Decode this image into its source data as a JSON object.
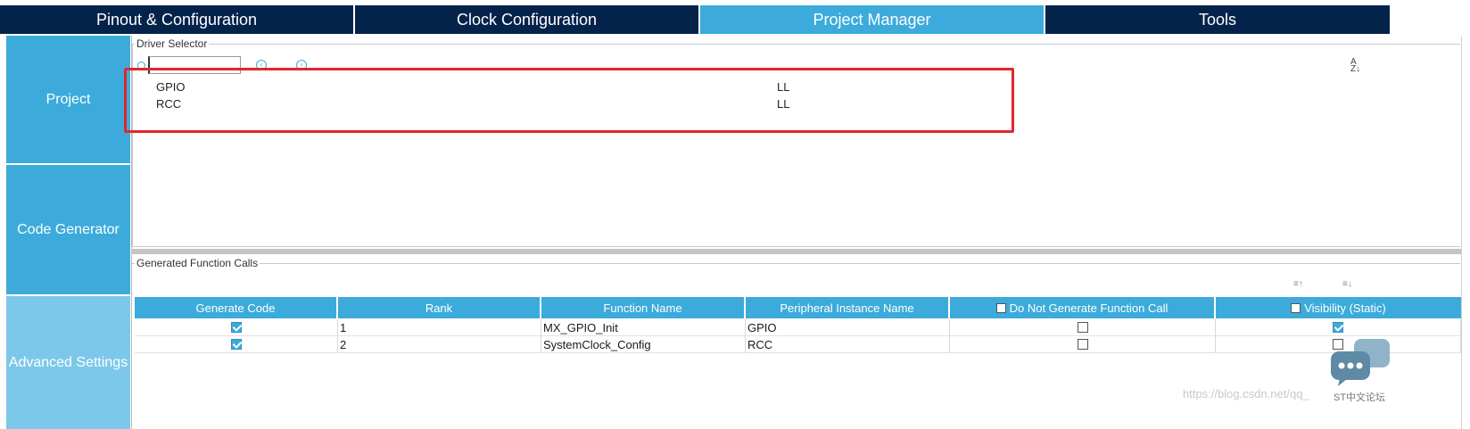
{
  "tabs": [
    {
      "label": "Pinout & Configuration",
      "active": false
    },
    {
      "label": "Clock Configuration",
      "active": false
    },
    {
      "label": "Project Manager",
      "active": true
    },
    {
      "label": "Tools",
      "active": false
    }
  ],
  "sidebar": {
    "items": [
      {
        "label": "Project"
      },
      {
        "label": "Code Generator"
      },
      {
        "label": "Advanced Settings"
      }
    ]
  },
  "driver_selector": {
    "legend": "Driver Selector",
    "search": {
      "value": "",
      "placeholder": ""
    },
    "rows": [
      {
        "peripheral": "GPIO",
        "driver": "LL"
      },
      {
        "peripheral": "RCC",
        "driver": "LL"
      }
    ]
  },
  "function_calls": {
    "legend": "Generated Function Calls",
    "headers": {
      "generate_code": "Generate Code",
      "rank": "Rank",
      "function_name": "Function Name",
      "peripheral_instance": "Peripheral Instance Name",
      "do_not_generate": "Do Not Generate Function Call",
      "visibility": "Visibility (Static)"
    },
    "rows": [
      {
        "generate": true,
        "rank": "1",
        "function": "MX_GPIO_Init",
        "instance": "GPIO",
        "do_not_generate": false,
        "visibility": true
      },
      {
        "generate": true,
        "rank": "2",
        "function": "SystemClock_Config",
        "instance": "RCC",
        "do_not_generate": false,
        "visibility": false
      }
    ]
  },
  "watermark": "https://blog.csdn.net/qq_",
  "chat_label": "ST中文论坛",
  "colors": {
    "tab_dark": "#03234b",
    "accent": "#3cabdb",
    "highlight": "#e3262d"
  }
}
